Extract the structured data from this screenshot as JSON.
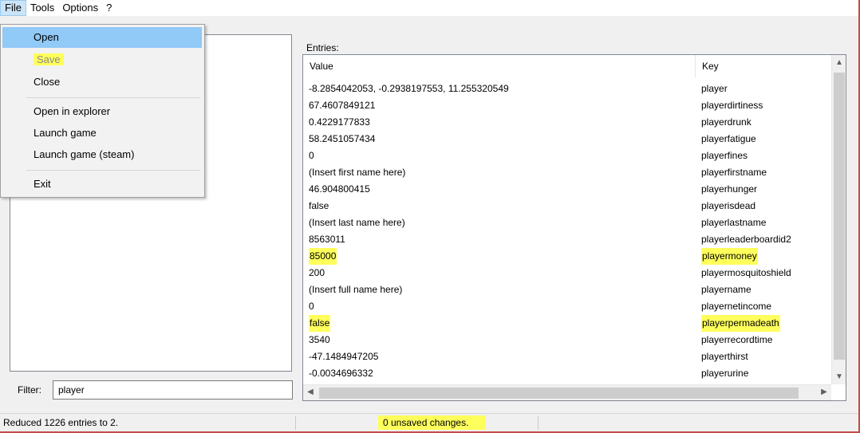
{
  "menubar": {
    "items": [
      "File",
      "Tools",
      "Options",
      "?"
    ]
  },
  "file_menu": {
    "open": "Open",
    "save": "Save",
    "close": "Close",
    "open_in_explorer": "Open in explorer",
    "launch_game": "Launch game",
    "launch_game_steam": "Launch game (steam)",
    "exit": "Exit"
  },
  "filter": {
    "label": "Filter:",
    "value": "player"
  },
  "entries": {
    "label": "Entries:",
    "columns": {
      "value": "Value",
      "key": "Key"
    },
    "rows": [
      {
        "value": "-8.2854042053, -0.2938197553, 11.255320549",
        "key": "player"
      },
      {
        "value": "67.4607849121",
        "key": "playerdirtiness"
      },
      {
        "value": "0.4229177833",
        "key": "playerdrunk"
      },
      {
        "value": "58.2451057434",
        "key": "playerfatigue"
      },
      {
        "value": "0",
        "key": "playerfines"
      },
      {
        "value": "(Insert first name here)",
        "key": "playerfirstname"
      },
      {
        "value": "46.904800415",
        "key": "playerhunger"
      },
      {
        "value": "false",
        "key": "playerisdead"
      },
      {
        "value": "(Insert last name here)",
        "key": "playerlastname"
      },
      {
        "value": "8563011",
        "key": "playerleaderboardid2"
      },
      {
        "value": "85000",
        "key": "playermoney"
      },
      {
        "value": "200",
        "key": "playermosquitoshield"
      },
      {
        "value": "(Insert full name here)",
        "key": "playername"
      },
      {
        "value": "0",
        "key": "playernetincome"
      },
      {
        "value": "false",
        "key": "playerpermadeath"
      },
      {
        "value": "3540",
        "key": "playerrecordtime"
      },
      {
        "value": "-47.1484947205",
        "key": "playerthirst"
      },
      {
        "value": "-0.0034696332",
        "key": "playerurine"
      }
    ]
  },
  "status": {
    "left": "Reduced 1226 entries to 2.",
    "middle": "0 unsaved changes."
  },
  "colors": {
    "highlight": "#ffff5c",
    "menu_selected": "#91c9f7",
    "window_border": "#c64a4a"
  }
}
